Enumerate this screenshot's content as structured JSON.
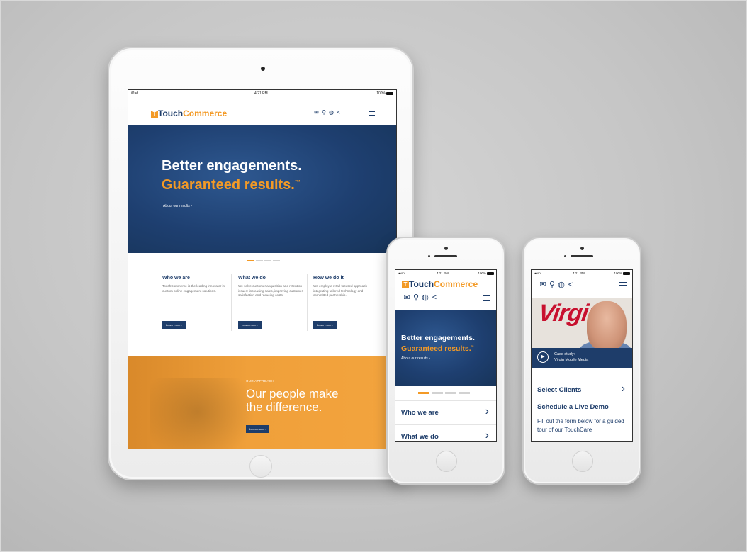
{
  "ipad": {
    "status": {
      "device": "iPad",
      "time": "4:21 PM",
      "battery": "100%"
    },
    "logo": {
      "mark": "T",
      "touch": "Touch",
      "commerce": "Commerce"
    },
    "header_icons": [
      "mail-icon",
      "search-icon",
      "globe-icon",
      "share-icon"
    ],
    "hero": {
      "headline": "Better engagements.",
      "subheadline": "Guaranteed results.",
      "trademark": "™",
      "link": "About our results ›"
    },
    "carousel": {
      "total": 4,
      "active": 1
    },
    "columns": [
      {
        "title": "Who we are",
        "body": "TouchCommerce is the leading innovator in custom online engagement solutions.",
        "button": "Learn more ›"
      },
      {
        "title": "What we do",
        "body": "We solve customer acquisition and retention issues: increasing sales, improving customer satisfaction and reducing costs.",
        "button": "Learn more ›"
      },
      {
        "title": "How we do it",
        "body": "We employ a retail-focused approach integrating tailored technology and committed partnership.",
        "button": "Learn more ›"
      }
    ],
    "approach": {
      "kicker": "OUR APPROACH",
      "headline_1": "Our people make",
      "headline_2": "the difference.",
      "button": "Learn more ›"
    }
  },
  "iphone1": {
    "status": {
      "carrier": "•••oo",
      "time": "4:21 PM",
      "battery": "100%"
    },
    "logo": {
      "mark": "T",
      "touch": "Touch",
      "commerce": "Commerce"
    },
    "hero": {
      "headline": "Better engagements.",
      "subheadline": "Guaranteed results.",
      "trademark": "™",
      "link": "About our results ›"
    },
    "carousel": {
      "total": 4,
      "active": 1
    },
    "rows": [
      {
        "label": "Who we are"
      },
      {
        "label": "What we do"
      }
    ],
    "chevron": "›"
  },
  "iphone2": {
    "status": {
      "carrier": "•••oo",
      "time": "4:21 PM",
      "battery": "100%"
    },
    "case_study": {
      "brand": "Virgin",
      "label": "Case study:",
      "title": "Virgin Mobile Media"
    },
    "rows": [
      {
        "label": "Select Clients"
      }
    ],
    "chevron": "›",
    "demo": {
      "title": "Schedule a Live Demo",
      "body": "Fill out the form below for a guided tour of our TouchCare"
    }
  },
  "colors": {
    "navy": "#1e3d6a",
    "orange": "#f39a26",
    "virgin_red": "#c8102e"
  }
}
